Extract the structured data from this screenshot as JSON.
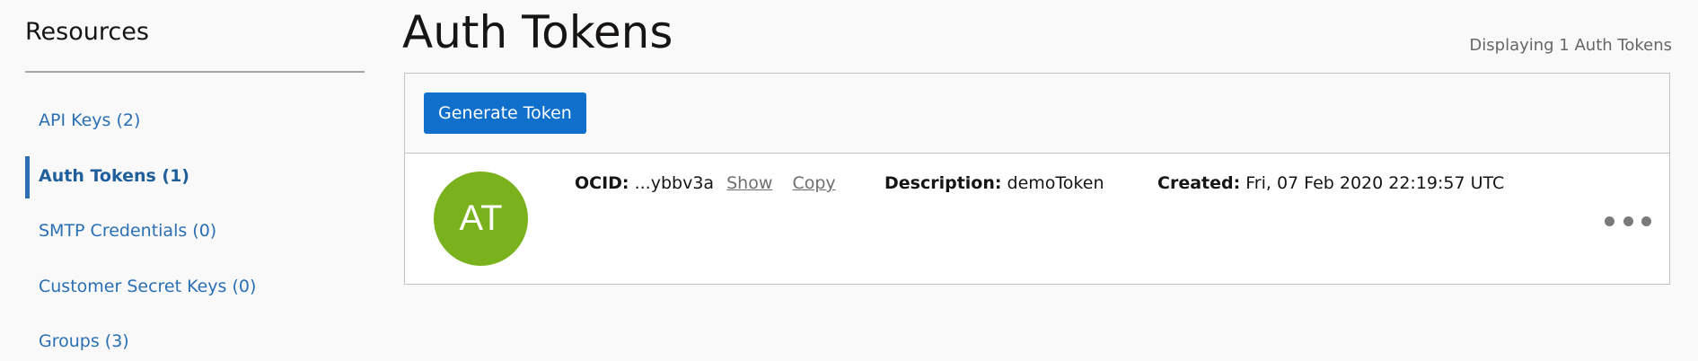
{
  "sidebar": {
    "title": "Resources",
    "items": [
      {
        "label": "API Keys (2)",
        "active": false
      },
      {
        "label": "Auth Tokens (1)",
        "active": true
      },
      {
        "label": "SMTP Credentials (0)",
        "active": false
      },
      {
        "label": "Customer Secret Keys (0)",
        "active": false
      },
      {
        "label": "Groups (3)",
        "active": false
      }
    ]
  },
  "main": {
    "title": "Auth Tokens",
    "display_count": "Displaying 1 Auth Tokens",
    "toolbar": {
      "generate_label": "Generate Token"
    },
    "tokens": [
      {
        "avatar_initials": "AT",
        "avatar_color": "#79b21d",
        "ocid_label": "OCID:",
        "ocid_value": "...ybbv3a",
        "show_label": "Show",
        "copy_label": "Copy",
        "description_label": "Description:",
        "description_value": "demoToken",
        "created_label": "Created:",
        "created_value": "Fri, 07 Feb 2020 22:19:57 UTC",
        "actions_icon": "more-horizontal-icon"
      }
    ]
  },
  "colors": {
    "accent": "#0f6fcb",
    "link": "#2a6fb4",
    "avatar": "#79b21d"
  }
}
